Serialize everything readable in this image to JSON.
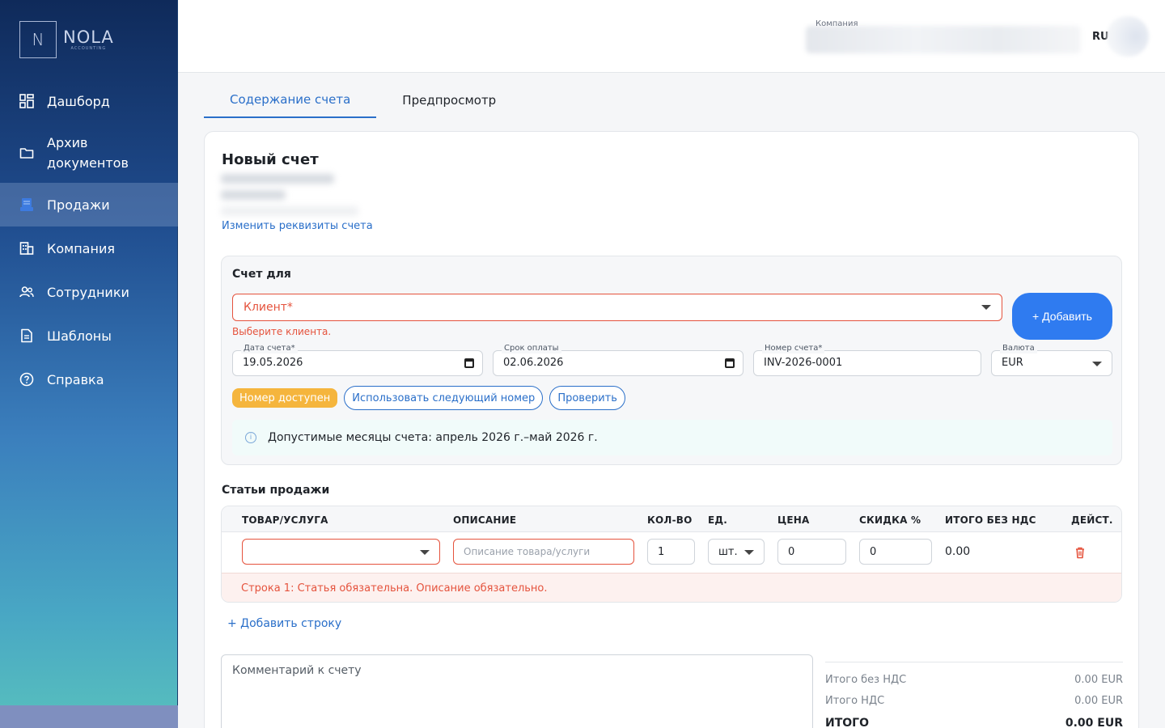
{
  "brand": {
    "logo_letter": "N",
    "logo_name": "NOLA",
    "logo_sub": "ACCOUNTING"
  },
  "sidebar": {
    "items": [
      {
        "label": "Дашборд",
        "icon": "grid-icon"
      },
      {
        "label": "Архив\nдокументов",
        "icon": "folder-icon"
      },
      {
        "label": "Продажи",
        "icon": "sales-icon",
        "active": true
      },
      {
        "label": "Компания",
        "icon": "building-icon"
      },
      {
        "label": "Сотрудники",
        "icon": "people-icon"
      },
      {
        "label": "Шаблоны",
        "icon": "document-icon"
      },
      {
        "label": "Справка",
        "icon": "help-icon"
      }
    ]
  },
  "header": {
    "company_label": "Компания",
    "lang": "RU"
  },
  "tabs": [
    {
      "label": "Содержание счета",
      "active": true
    },
    {
      "label": "Предпросмотр",
      "active": false
    }
  ],
  "invoice": {
    "title": "Новый счет",
    "edit_link": "Изменить реквизиты счета",
    "bill_to": {
      "title": "Счет для",
      "client_placeholder": "Клиент*",
      "client_error": "Выберите клиента.",
      "add_button": "+ Добавить"
    },
    "fields": {
      "date_label": "Дата счета*",
      "date_value": "19.05.2026",
      "due_label": "Срок оплаты",
      "due_value": "02.06.2026",
      "number_label": "Номер счета*",
      "number_value": "INV-2026-0001",
      "currency_label": "Валюта",
      "currency_value": "EUR"
    },
    "pills": {
      "status": "Номер доступен",
      "next": "Использовать следующий номер",
      "check": "Проверить"
    },
    "info": "Допустимые месяцы счета: апрель 2026 г.–май 2026 г.",
    "items": {
      "title": "Статьи продажи",
      "columns": [
        "ТОВАР/УСЛУГА",
        "ОПИСАНИЕ",
        "КОЛ-ВО",
        "ЕД.",
        "ЦЕНА",
        "СКИДКА %",
        "ИТОГО БЕЗ НДС",
        "ДЕЙСТ."
      ],
      "row": {
        "description_placeholder": "Описание товара/услуги",
        "qty": "1",
        "unit": "шт.",
        "price": "0",
        "discount": "0",
        "total": "0.00"
      },
      "row_error": "Строка 1: Статья обязательна. Описание обязательно.",
      "add_row": "+ Добавить строку"
    },
    "comment_placeholder": "Комментарий к счету",
    "totals": {
      "net_label": "Итого без НДС",
      "net_value": "0.00 EUR",
      "vat_label": "Итого НДС",
      "vat_value": "0.00 EUR",
      "grand_label": "ИТОГО",
      "grand_value": "0.00 EUR"
    }
  },
  "colors": {
    "accent": "#2a6fc9",
    "button": "#2f7bf0",
    "error": "#e5533d",
    "status_badge": "#f5b53d"
  }
}
